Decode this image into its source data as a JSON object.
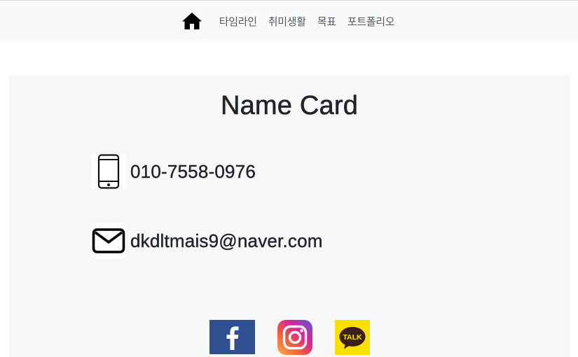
{
  "navbar": {
    "home_icon": "home-icon",
    "links": [
      {
        "label": "타임라인"
      },
      {
        "label": "취미생활"
      },
      {
        "label": "목표"
      },
      {
        "label": "포트폴리오"
      }
    ]
  },
  "card": {
    "title": "Name Card",
    "phone": {
      "icon": "smartphone-icon",
      "value": "010-7558-0976"
    },
    "email": {
      "icon": "envelope-icon",
      "value": "dkdltmais9@naver.com"
    },
    "social": [
      {
        "name": "facebook",
        "icon": "facebook-icon",
        "color": "#3b5998"
      },
      {
        "name": "instagram",
        "icon": "instagram-icon",
        "color": "#d6249f"
      },
      {
        "name": "kakaotalk",
        "icon": "kakaotalk-icon",
        "color": "#f9e000",
        "badge_text": "TALK"
      }
    ]
  },
  "colors": {
    "navbar_bg": "#f8f9fa",
    "card_bg": "#f6f7f9",
    "text": "#212529",
    "nav_text": "#555a5f"
  }
}
